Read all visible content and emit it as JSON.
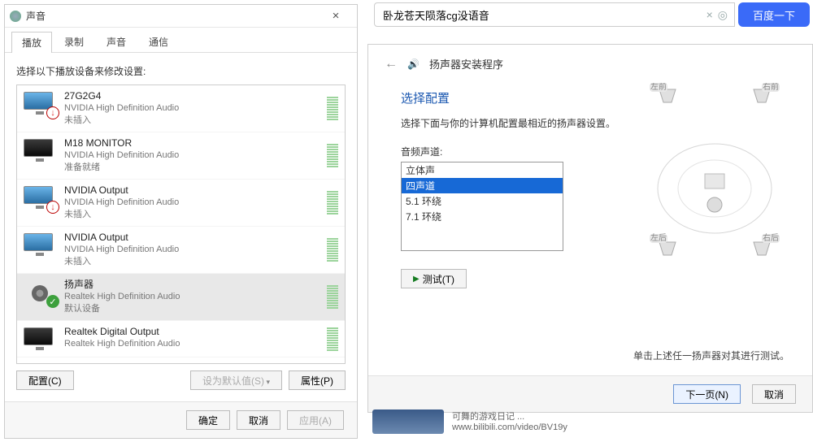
{
  "sound_dialog": {
    "title": "声音",
    "tabs": {
      "play": "播放",
      "record": "录制",
      "sound": "声音",
      "comm": "通信"
    },
    "instruction": "选择以下播放设备来修改设置:",
    "devices": [
      {
        "name": "27G2G4",
        "mfr": "NVIDIA High Definition Audio",
        "status": "未插入",
        "icon": "monitor",
        "overlay": "down"
      },
      {
        "name": "M18  MONITOR",
        "mfr": "NVIDIA High Definition Audio",
        "status": "准备就绪",
        "icon": "monitor-dark"
      },
      {
        "name": "NVIDIA Output",
        "mfr": "NVIDIA High Definition Audio",
        "status": "未插入",
        "icon": "monitor",
        "overlay": "down"
      },
      {
        "name": "NVIDIA Output",
        "mfr": "NVIDIA High Definition Audio",
        "status": "未插入",
        "icon": "monitor"
      },
      {
        "name": "扬声器",
        "mfr": "Realtek High Definition Audio",
        "status": "默认设备",
        "icon": "speaker",
        "overlay": "check",
        "selected": true
      },
      {
        "name": "Realtek Digital Output",
        "mfr": "Realtek High Definition Audio",
        "status": "",
        "icon": "monitor-dark"
      }
    ],
    "buttons": {
      "configure": "配置(C)",
      "set_default": "设为默认值(S)",
      "properties": "属性(P)"
    },
    "bottom": {
      "ok": "确定",
      "cancel": "取消",
      "apply": "应用(A)"
    }
  },
  "search": {
    "value": "卧龙苍天陨落cg没语音",
    "button": "百度一下"
  },
  "wizard": {
    "title": "扬声器安装程序",
    "heading": "选择配置",
    "subtext": "选择下面与你的计算机配置最相近的扬声器设置。",
    "channel_label": "音频声道:",
    "channels": [
      "立体声",
      "四声道",
      "5.1 环绕",
      "7.1 环绕"
    ],
    "selected_channel": "四声道",
    "test_button": "测试(T)",
    "speaker_tags": {
      "fl": "左前",
      "fr": "右前",
      "rl": "左后",
      "rr": "右后"
    },
    "hint": "单击上述任一扬声器对其进行测试。",
    "footer": {
      "next": "下一页(N)",
      "cancel": "取消"
    }
  },
  "video_strip": {
    "title": "可舞的游戏日记 ...",
    "url": "www.bilibili.com/video/BV19y"
  }
}
